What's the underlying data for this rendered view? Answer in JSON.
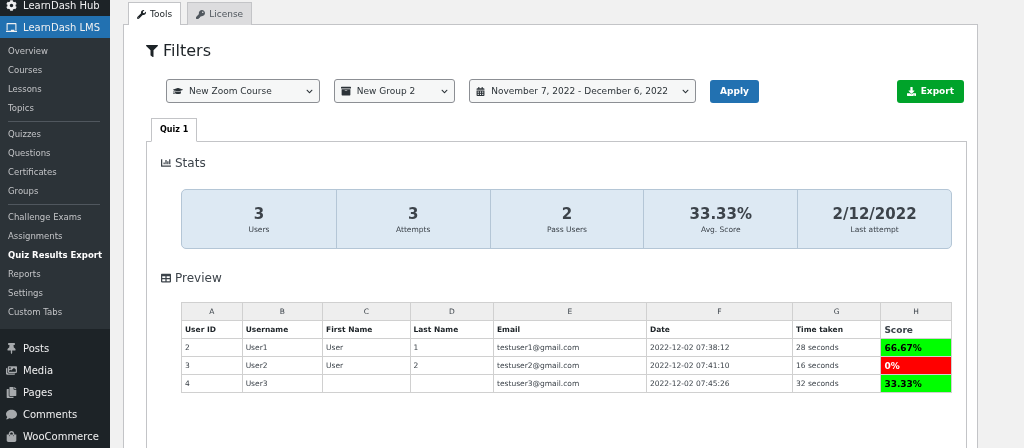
{
  "sidebar": {
    "top_item": {
      "label": "LearnDash Hub"
    },
    "active_menu": {
      "label": "LearnDash LMS",
      "selected": true,
      "groups": [
        [
          {
            "label": "Overview",
            "selected": false
          },
          {
            "label": "Courses",
            "selected": false
          },
          {
            "label": "Lessons",
            "selected": false
          },
          {
            "label": "Topics",
            "selected": false
          }
        ],
        [
          {
            "label": "Quizzes",
            "selected": false
          },
          {
            "label": "Questions",
            "selected": false
          },
          {
            "label": "Certificates",
            "selected": false
          },
          {
            "label": "Groups",
            "selected": false
          }
        ],
        [
          {
            "label": "Challenge Exams",
            "selected": false
          },
          {
            "label": "Assignments",
            "selected": false
          },
          {
            "label": "Quiz Results Export",
            "selected": true
          },
          {
            "label": "Reports",
            "selected": false
          },
          {
            "label": "Settings",
            "selected": false
          },
          {
            "label": "Custom Tabs",
            "selected": false
          }
        ]
      ]
    },
    "items": [
      {
        "label": "Posts"
      },
      {
        "label": "Media"
      },
      {
        "label": "Pages"
      },
      {
        "label": "Comments"
      },
      {
        "label": "WooCommerce"
      }
    ]
  },
  "tabs": [
    {
      "label": "Tools",
      "selected": true
    },
    {
      "label": "License",
      "selected": false
    }
  ],
  "filters": {
    "title": "Filters",
    "course": "New Zoom Course",
    "group": "New Group 2",
    "date_range": "November 7, 2022 - December 6, 2022",
    "apply": "Apply",
    "export": "Export"
  },
  "quiz_tabs": [
    {
      "label": "Quiz 1",
      "selected": true
    }
  ],
  "stats": {
    "title": "Stats",
    "items": [
      {
        "value": "3",
        "label": "Users"
      },
      {
        "value": "3",
        "label": "Attempts"
      },
      {
        "value": "2",
        "label": "Pass Users"
      },
      {
        "value": "33.33%",
        "label": "Avg. Score"
      },
      {
        "value": "2/12/2022",
        "label": "Last attempt"
      }
    ]
  },
  "preview": {
    "title": "Preview",
    "letters": [
      "A",
      "B",
      "C",
      "D",
      "E",
      "F",
      "G",
      "H"
    ],
    "columns": [
      "User ID",
      "Username",
      "First Name",
      "Last Name",
      "Email",
      "Date",
      "Time taken",
      "Score"
    ],
    "rows": [
      {
        "cells": [
          "2",
          "User1",
          "User",
          "1",
          "testuser1@gmail.com",
          "2022-12-02 07:38:12",
          "28 seconds"
        ],
        "score": "66.67%",
        "color": "#00ff00"
      },
      {
        "cells": [
          "3",
          "User2",
          "User",
          "2",
          "testuser2@gmail.com",
          "2022-12-02 07:41:10",
          "16 seconds"
        ],
        "score": "0%",
        "color": "#ff0000"
      },
      {
        "cells": [
          "4",
          "User3",
          null,
          null,
          "testuser3@gmail.com",
          "2022-12-02 07:45:26",
          "32 seconds"
        ],
        "score": "33.33%",
        "color": "#00ff00"
      }
    ]
  }
}
